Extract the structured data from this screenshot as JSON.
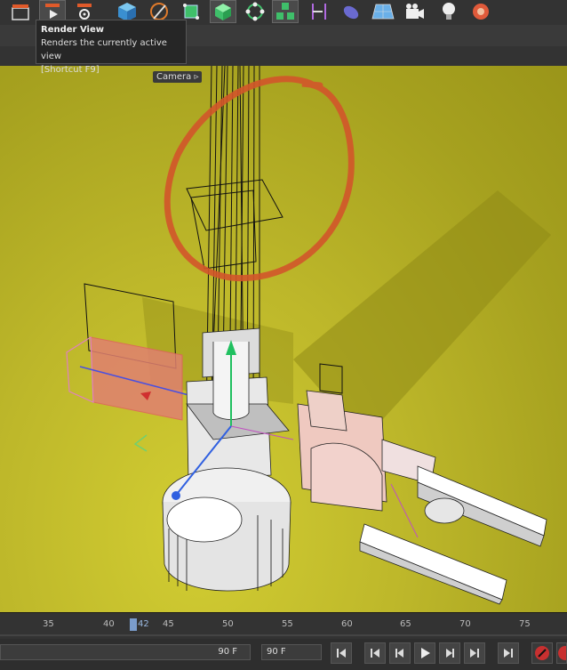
{
  "tooltip": {
    "title": "Render View",
    "description": "Renders the currently active view",
    "shortcut": "[Shortcut F9]"
  },
  "toolbar": {
    "icons": [
      "clapboard-icon",
      "render-view-icon",
      "render-settings-icon",
      "cube-icon",
      "pen-icon",
      "subdivision-icon",
      "cube-generator-icon",
      "spline-points-icon",
      "cloner-icon",
      "deformer-icon",
      "sky-icon",
      "floor-icon",
      "camera-icon",
      "light-icon",
      "material-icon"
    ]
  },
  "viewport": {
    "camera_label": "Camera",
    "background_color": "#bdb72a"
  },
  "timeline": {
    "ticks": [
      "35",
      "40",
      "42",
      "45",
      "50",
      "55",
      "60",
      "65",
      "70",
      "75"
    ],
    "current_frame": "42"
  },
  "transport": {
    "current_value": "90 F",
    "end_value": "90 F"
  }
}
